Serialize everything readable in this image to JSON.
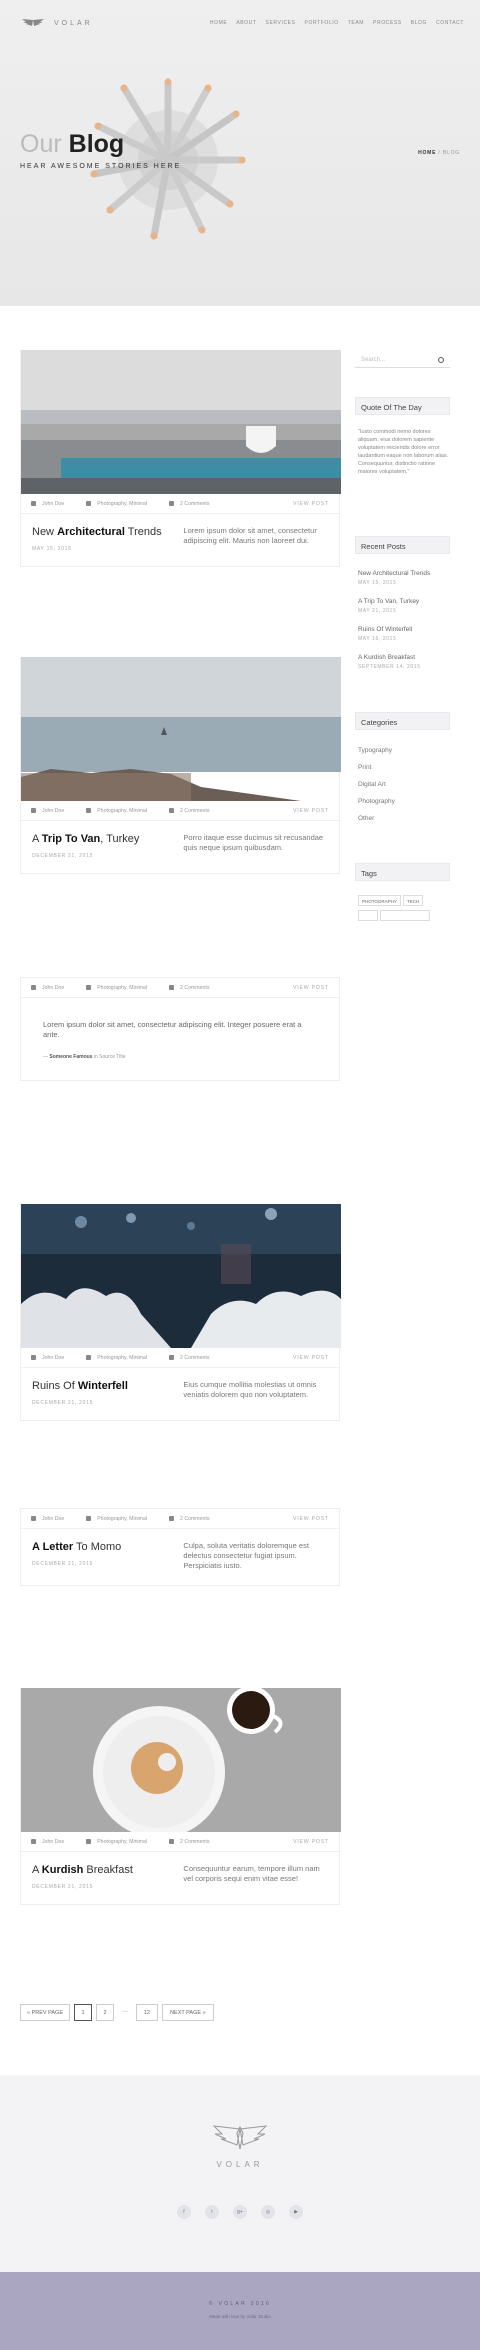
{
  "brand": "VOLAR",
  "nav": [
    "HOME",
    "ABOUT",
    "SERVICES",
    "PORTFOLIO",
    "TEAM",
    "PROCESS",
    "BLOG",
    "CONTACT"
  ],
  "hero": {
    "title_light": "Our",
    "title_bold": "Blog",
    "subtitle": "HEAR AWESOME STORIES HERE",
    "crumb_home": "HOME",
    "crumb_sep": "/",
    "crumb_current": "BLOG"
  },
  "posts": [
    {
      "author": "John Doe",
      "cats": "Photography, Minimal",
      "comments": "2 Comments",
      "view": "VIEW POST",
      "title_pre": "New ",
      "title_bold": "Architectural",
      "title_post": " Trends",
      "date": "MAY 15, 2015",
      "excerpt": "Lorem ipsum dolor sit amet, consectetur adipiscing elit. Mauris non laoreet dui."
    },
    {
      "author": "John Doe",
      "cats": "Photography, Minimal",
      "comments": "2 Comments",
      "view": "VIEW POST",
      "title_pre": "A ",
      "title_bold": "Trip To Van",
      "title_post": ", Turkey",
      "date": "DECEMBER 21, 2015",
      "excerpt": "Porro itaque esse ducimus sit recusandae quis neque ipsum quibusdam."
    },
    {
      "author": "John Doe",
      "cats": "Photography, Minimal",
      "comments": "2 Comments",
      "view": "VIEW POST",
      "quote": "Lorem ipsum dolor sit amet, consectetur adipiscing elit. Integer posuere erat a ante.",
      "quote_author": "Someone Famous",
      "quote_in": " in ",
      "quote_source": "Source Title"
    },
    {
      "author": "John Doe",
      "cats": "Photography, Minimal",
      "comments": "2 Comments",
      "view": "VIEW POST",
      "title_pre": "Ruins Of ",
      "title_bold": "Winterfell",
      "title_post": "",
      "date": "DECEMBER 21, 2015",
      "excerpt": "Eius cumque mollitia molestias ut omnis veniatis dolorem quo non voluptatem."
    },
    {
      "author": "John Doe",
      "cats": "Photography, Minimal",
      "comments": "2 Comments",
      "view": "VIEW POST",
      "title_pre": "",
      "title_bold": "A Letter",
      "title_post": " To Momo",
      "date": "DECEMBER 21, 2015",
      "excerpt": "Culpa, soluta veritatis doloremque est delectus consectetur fugiat ipsum. Perspiciatis iusto."
    },
    {
      "author": "John Doe",
      "cats": "Photography, Minimal",
      "comments": "2 Comments",
      "view": "VIEW POST",
      "title_pre": "A ",
      "title_bold": "Kurdish",
      "title_post": " Breakfast",
      "date": "DECEMBER 21, 2015",
      "excerpt": "Consequuntur earum, tempore illum nam vel corporis sequi enim vitae esse!"
    }
  ],
  "sidebar": {
    "search_placeholder": "Search...",
    "quote_title": "Quote Of The Day",
    "quote_text": "\"Iusto commodi nemo dolores aliquam, eius dolorem sapiente voluptatem reiciendis dolore error laudantium eaque non laborum alias. Consequuntur, distinctio ratione maiores voluptatem.\"",
    "recent_title": "Recent Posts",
    "recent": [
      {
        "title": "New Architectural Trends",
        "date": "MAY 15, 2015"
      },
      {
        "title": "A Trip To Van, Turkey",
        "date": "MAY 21, 2015"
      },
      {
        "title": "Ruins Of Winterfell",
        "date": "MAY 16, 2015"
      },
      {
        "title": "A Kurdish Breakfast",
        "date": "SEPTEMBER 14, 2015"
      }
    ],
    "categories_title": "Categories",
    "categories": [
      "Typography",
      "Print",
      "Digital Art",
      "Photography",
      "Other"
    ],
    "tags_title": "Tags",
    "tags": [
      "PHOTOGRAPHY",
      "TECH",
      "",
      ""
    ]
  },
  "pager": {
    "prev": "« PREV PAGE",
    "pages": [
      "1",
      "2",
      "...",
      "12"
    ],
    "next": "NEXT PAGE »"
  },
  "footer": {
    "brand": "VOLAR",
    "social": [
      "facebook-icon",
      "twitter-icon",
      "google-plus-icon",
      "dribbble-icon",
      "youtube-icon"
    ],
    "copyright": "© VOLAR 2016",
    "made": "Made with love by Volar Studio"
  }
}
